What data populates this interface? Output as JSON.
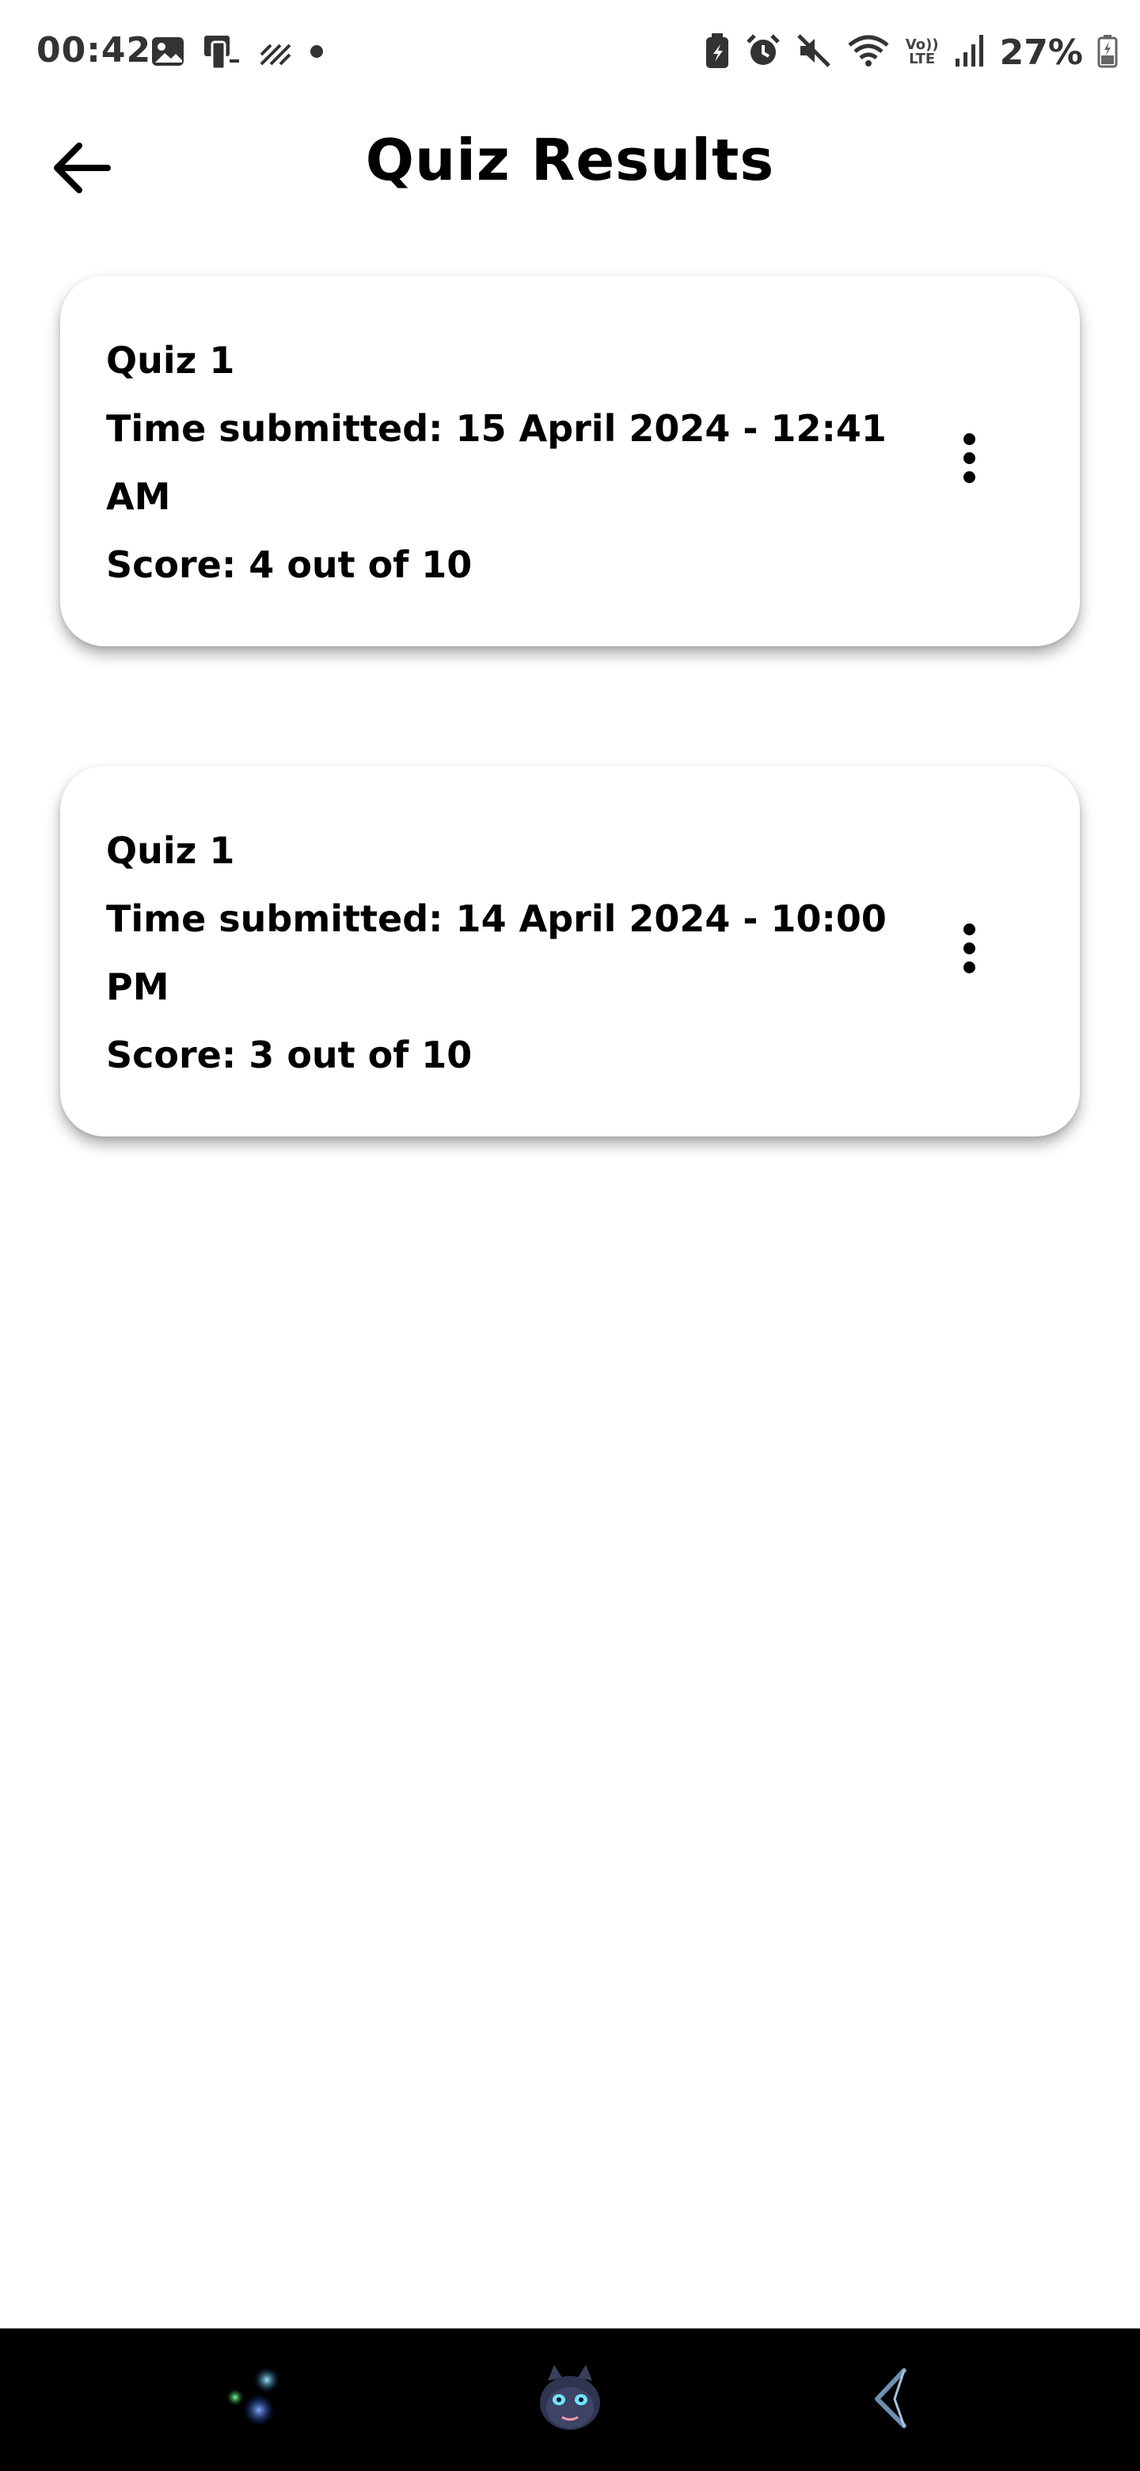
{
  "status_bar": {
    "time": "00:42",
    "battery_percent": "27%",
    "network_label_top": "Vo))",
    "network_label_bottom": "LTE"
  },
  "header": {
    "title": "Quiz Results"
  },
  "results": [
    {
      "quiz_name": "Quiz 1",
      "time_line_1": "Time submitted: 15 April 2024 - 12:41",
      "time_line_2": "AM",
      "score": "Score: 4 out of 10"
    },
    {
      "quiz_name": "Quiz 1",
      "time_line_1": "Time submitted: 14 April 2024 - 10:00",
      "time_line_2": "PM",
      "score": "Score: 3 out of 10"
    }
  ],
  "icons": {
    "back": "arrow-left-icon",
    "more": "more-vertical-icon",
    "nav_left": "assistant-dots-icon",
    "nav_center": "dragon-avatar-icon",
    "nav_right": "back-gesture-icon"
  },
  "colors": {
    "background": "#ffffff",
    "text": "#000000",
    "nav_bar": "#000000",
    "card_shadow": "rgba(0,0,0,0.32)"
  }
}
